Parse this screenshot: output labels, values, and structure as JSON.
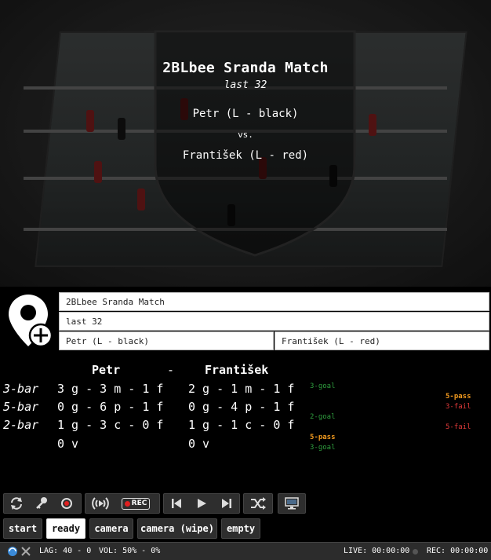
{
  "overlay": {
    "title": "2BLbee Sranda Match",
    "round": "last 32",
    "player1": "Petr (L - black)",
    "vs": "vs.",
    "player2": "František (L - red)"
  },
  "form": {
    "match_name": "2BLbee Sranda Match",
    "round": "last 32",
    "player1": "Petr (L - black)",
    "player2": "František (L - red)"
  },
  "scoreboard": {
    "header": {
      "player1": "Petr",
      "sep": "-",
      "player2": "František"
    },
    "rows": [
      {
        "label": "3-bar",
        "p1": "3 g - 3 m - 1 f",
        "p2": "2 g - 1 m - 1 f"
      },
      {
        "label": "5-bar",
        "p1": "0 g - 6 p - 1 f",
        "p2": "0 g - 4 p - 1 f"
      },
      {
        "label": "2-bar",
        "p1": "1 g - 3 c - 0 f",
        "p2": "1 g - 1 c - 0 f"
      },
      {
        "label": "",
        "p1": "0 v",
        "p2": "0 v"
      }
    ],
    "events_left": [
      {
        "text": "3-goal",
        "color": "#2e9e3e"
      },
      {
        "text": "2-goal",
        "color": "#2e9e3e"
      },
      {
        "text": "5-pass",
        "color": "#f29a1f"
      },
      {
        "text": "3-goal",
        "color": "#2e9e3e"
      }
    ],
    "events_right": [
      {
        "text": "5-pass",
        "color": "#f29a1f"
      },
      {
        "text": "3-fail",
        "color": "#e03a3a"
      },
      {
        "text": "5-fail",
        "color": "#e03a3a"
      }
    ]
  },
  "toolbar": {
    "icons": [
      "refresh-icon",
      "key-icon",
      "record-dot-icon",
      "broadcast-icon",
      "rec-badge-icon",
      "skip-back-icon",
      "play-icon",
      "skip-forward-icon",
      "shuffle-icon",
      "monitor-icon"
    ],
    "rec_label": "REC"
  },
  "scenes": {
    "start": "start",
    "ready": "ready",
    "camera": "camera",
    "camera_wipe": "camera (wipe)",
    "empty": "empty",
    "active": "ready"
  },
  "status": {
    "lag": "LAG: 40 - 0",
    "vol": "VOL: 50% - 0%",
    "live": "LIVE: 00:00:00",
    "rec": "REC: 00:00:00"
  },
  "colors": {
    "accent_green": "#2e9e3e",
    "accent_orange": "#f29a1f",
    "accent_red": "#e03a3a",
    "rec_red": "#e02020"
  }
}
